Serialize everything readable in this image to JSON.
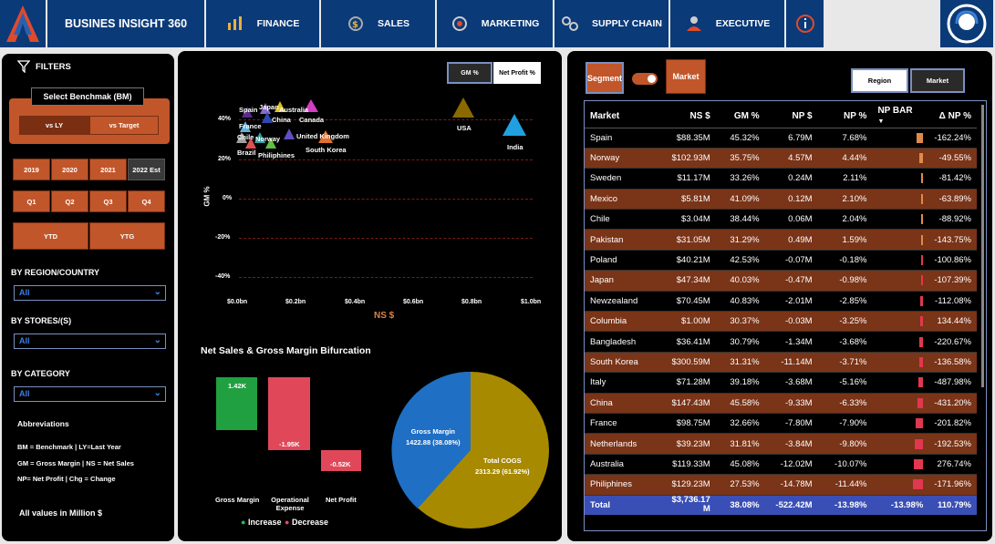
{
  "app": {
    "title": "BUSINES INSIGHT 360"
  },
  "nav": [
    {
      "label": "FINANCE",
      "icon": "finance-icon"
    },
    {
      "label": "SALES",
      "icon": "sales-icon"
    },
    {
      "label": "MARKETING",
      "icon": "marketing-icon"
    },
    {
      "label": "SUPPLY CHAIN",
      "icon": "supply-chain-icon"
    },
    {
      "label": "EXECUTIVE",
      "icon": "executive-icon"
    }
  ],
  "filters": {
    "title": "FILTERS",
    "benchmark_label": "Select Benchmak (BM)",
    "benchmark_options": [
      "vs LY",
      "vs Target"
    ],
    "years": [
      "2019",
      "2020",
      "2021",
      "2022 Est"
    ],
    "quarters": [
      "Q1",
      "Q2",
      "Q3",
      "Q4"
    ],
    "periods": [
      "YTD",
      "YTG"
    ],
    "region_label": "BY REGION/COUNTRY",
    "region_value": "All",
    "stores_label": "BY STORES/(S)",
    "stores_value": "All",
    "category_label": "BY CATEGORY",
    "category_value": "All",
    "abbr_title": "Abbreviations",
    "abbr_lines": [
      "BM = Benchmark | LY=Last Year",
      "GM = Gross Margin | NS = Net Sales",
      "NP= Net Profit | Chg = Change"
    ],
    "footer": "All values in Million $"
  },
  "scatter": {
    "toggle": [
      "GM %",
      "Net Profit %"
    ],
    "ylabel": "GM %",
    "xlabel": "NS $",
    "yticks": [
      "40%",
      "20%",
      "0%",
      "-20%",
      "-40%"
    ],
    "xticks": [
      "$0.0bn",
      "$0.2bn",
      "$0.4bn",
      "$0.6bn",
      "$0.8bn",
      "$1.0bn"
    ],
    "labels": [
      "Spain",
      "Japan",
      "Australia",
      "China",
      "Canada",
      "France",
      "Chile",
      "Norway",
      "United Kingdom",
      "Brazil",
      "Philiphines",
      "South Korea",
      "USA",
      "India"
    ]
  },
  "bifurcation": {
    "title": "Net Sales & Gross Margin Bifurcation",
    "bars": [
      {
        "label": "Gross Margin",
        "value": "1.42K"
      },
      {
        "label": "Operational Expense",
        "value": "-1.95K"
      },
      {
        "label": "Net Profit",
        "value": "-0.52K"
      }
    ],
    "legend": [
      "Increase",
      "Decrease"
    ],
    "pie": [
      {
        "label": "Gross Margin",
        "value": "1422.88 (38.08%)",
        "share": 38.08,
        "color": "#1f6fc4"
      },
      {
        "label": "Total COGS",
        "value": "2313.29 (61.92%)",
        "share": 61.92,
        "color": "#a88a00"
      }
    ]
  },
  "table_controls": {
    "segment": "Segment",
    "market": "Market",
    "view_options": [
      "Region",
      "Market"
    ]
  },
  "table": {
    "headers": [
      "Market",
      "NS $",
      "GM %",
      "NP $",
      "NP %",
      "NP BAR",
      "Δ NP %"
    ],
    "rows": [
      {
        "market": "Spain",
        "ns": "$88.35M",
        "gm": "45.32%",
        "np": "6.79M",
        "npp": "7.68%",
        "bar": 7.68,
        "dnp": "-162.24%"
      },
      {
        "market": "Norway",
        "ns": "$102.93M",
        "gm": "35.75%",
        "np": "4.57M",
        "npp": "4.44%",
        "bar": 4.44,
        "dnp": "-49.55%"
      },
      {
        "market": "Sweden",
        "ns": "$11.17M",
        "gm": "33.26%",
        "np": "0.24M",
        "npp": "2.11%",
        "bar": 2.11,
        "dnp": "-81.42%"
      },
      {
        "market": "Mexico",
        "ns": "$5.81M",
        "gm": "41.09%",
        "np": "0.12M",
        "npp": "2.10%",
        "bar": 2.1,
        "dnp": "-63.89%"
      },
      {
        "market": "Chile",
        "ns": "$3.04M",
        "gm": "38.44%",
        "np": "0.06M",
        "npp": "2.04%",
        "bar": 2.04,
        "dnp": "-88.92%"
      },
      {
        "market": "Pakistan",
        "ns": "$31.05M",
        "gm": "31.29%",
        "np": "0.49M",
        "npp": "1.59%",
        "bar": 1.59,
        "dnp": "-143.75%"
      },
      {
        "market": "Poland",
        "ns": "$40.21M",
        "gm": "42.53%",
        "np": "-0.07M",
        "npp": "-0.18%",
        "bar": -0.18,
        "dnp": "-100.86%"
      },
      {
        "market": "Japan",
        "ns": "$47.34M",
        "gm": "40.03%",
        "np": "-0.47M",
        "npp": "-0.98%",
        "bar": -0.98,
        "dnp": "-107.39%"
      },
      {
        "market": "Newzealand",
        "ns": "$70.45M",
        "gm": "40.83%",
        "np": "-2.01M",
        "npp": "-2.85%",
        "bar": -2.85,
        "dnp": "-112.08%"
      },
      {
        "market": "Columbia",
        "ns": "$1.00M",
        "gm": "30.37%",
        "np": "-0.03M",
        "npp": "-3.25%",
        "bar": -3.25,
        "dnp": "134.44%"
      },
      {
        "market": "Bangladesh",
        "ns": "$36.41M",
        "gm": "30.79%",
        "np": "-1.34M",
        "npp": "-3.68%",
        "bar": -3.68,
        "dnp": "-220.67%"
      },
      {
        "market": "South Korea",
        "ns": "$300.59M",
        "gm": "31.31%",
        "np": "-11.14M",
        "npp": "-3.71%",
        "bar": -3.71,
        "dnp": "-136.58%"
      },
      {
        "market": "Italy",
        "ns": "$71.28M",
        "gm": "39.18%",
        "np": "-3.68M",
        "npp": "-5.16%",
        "bar": -5.16,
        "dnp": "-487.98%"
      },
      {
        "market": "China",
        "ns": "$147.43M",
        "gm": "45.58%",
        "np": "-9.33M",
        "npp": "-6.33%",
        "bar": -6.33,
        "dnp": "-431.20%"
      },
      {
        "market": "France",
        "ns": "$98.75M",
        "gm": "32.66%",
        "np": "-7.80M",
        "npp": "-7.90%",
        "bar": -7.9,
        "dnp": "-201.82%"
      },
      {
        "market": "Netherlands",
        "ns": "$39.23M",
        "gm": "31.81%",
        "np": "-3.84M",
        "npp": "-9.80%",
        "bar": -9.8,
        "dnp": "-192.53%"
      },
      {
        "market": "Australia",
        "ns": "$119.33M",
        "gm": "45.08%",
        "np": "-12.02M",
        "npp": "-10.07%",
        "bar": -10.07,
        "dnp": "276.74%"
      },
      {
        "market": "Philiphines",
        "ns": "$129.23M",
        "gm": "27.53%",
        "np": "-14.78M",
        "npp": "-11.44%",
        "bar": -11.44,
        "dnp": "-171.96%"
      }
    ],
    "total": {
      "market": "Total",
      "ns": "$3,736.17 M",
      "gm": "38.08%",
      "np": "-522.42M",
      "npp": "-13.98%",
      "bar_text": "-13.98%",
      "dnp": "110.79%"
    }
  },
  "colors": {
    "nav": "#0b3a78",
    "accent": "#c1562a",
    "row_alt": "#7a3418",
    "total": "#3a4fb5",
    "positive": "#e08a4a",
    "negative": "#e0384f"
  }
}
